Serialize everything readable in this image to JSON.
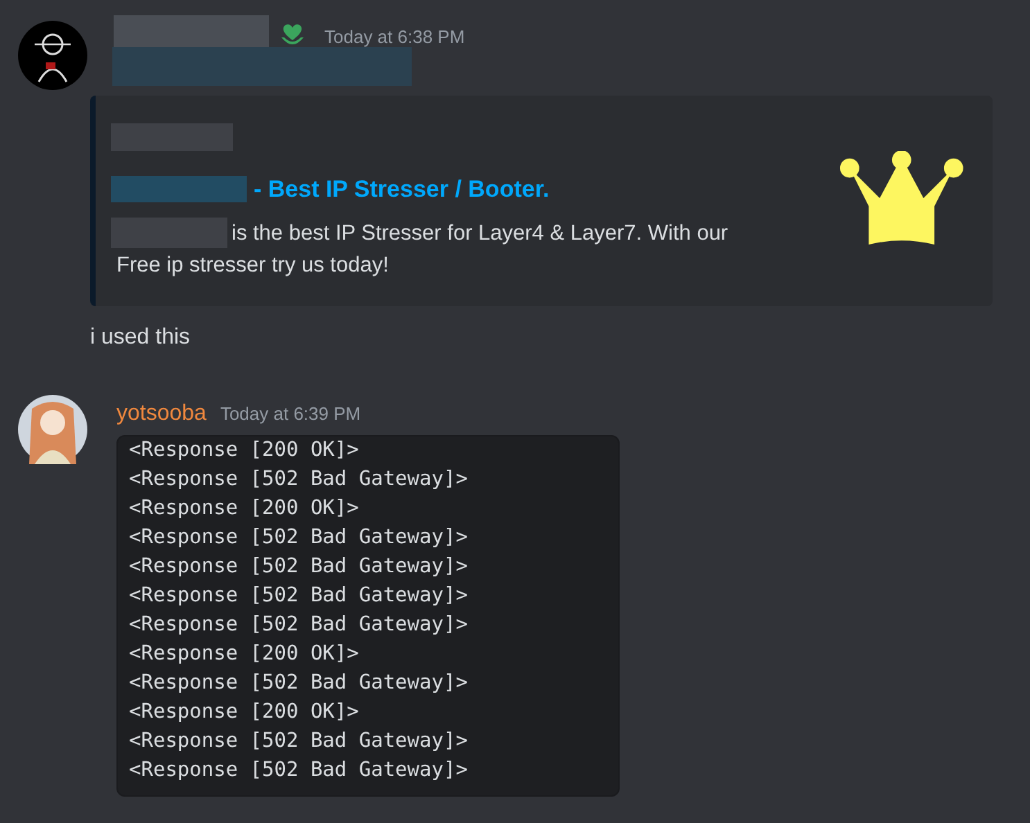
{
  "messages": [
    {
      "kind": "embed",
      "timestamp": "Today at 6:38 PM",
      "embed": {
        "title": "- Best IP Stresser / Booter.",
        "description_lines": [
          "is the best IP Stresser for Layer4 & Layer7. With our",
          "Free ip stresser try us today!"
        ]
      },
      "text": "i used this"
    },
    {
      "kind": "code",
      "author": "yotsooba",
      "timestamp": "Today at 6:39 PM",
      "code_lines": [
        "<Response [200 OK]>",
        "<Response [502 Bad Gateway]>",
        "<Response [200 OK]>",
        "<Response [502 Bad Gateway]>",
        "<Response [502 Bad Gateway]>",
        "<Response [502 Bad Gateway]>",
        "<Response [502 Bad Gateway]>",
        "<Response [200 OK]>",
        "<Response [502 Bad Gateway]>",
        "<Response [200 OK]>",
        "<Response [502 Bad Gateway]>",
        "<Response [502 Bad Gateway]>"
      ]
    }
  ]
}
